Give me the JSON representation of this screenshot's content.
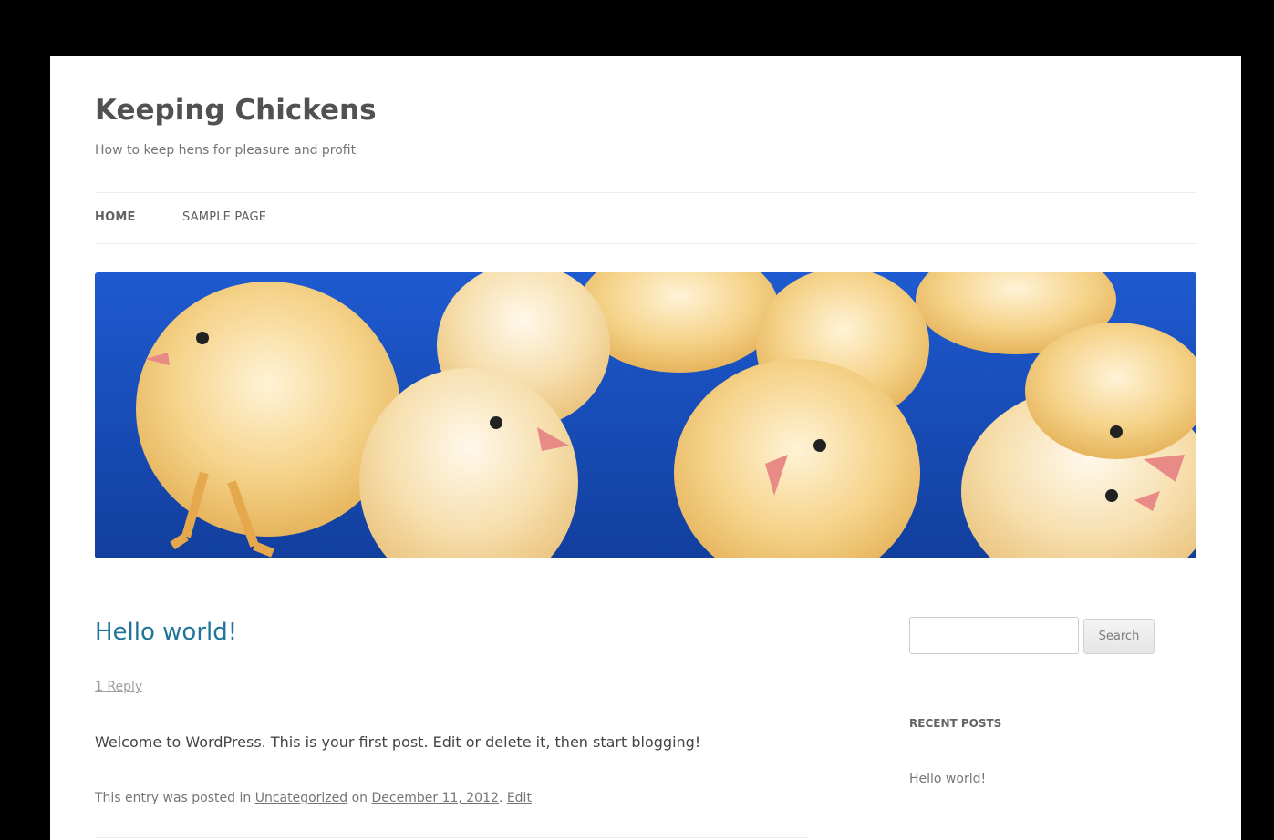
{
  "site": {
    "title": "Keeping Chickens",
    "description": "How to keep hens for pleasure and profit"
  },
  "nav": {
    "items": [
      {
        "label": "Home",
        "active": true
      },
      {
        "label": "Sample Page",
        "active": false
      }
    ]
  },
  "header_image": {
    "subject": "yellow-chicks-on-blue-background",
    "colors": {
      "background": "#1a4fbf",
      "chick": "#f5d38a",
      "beak": "#e88a86"
    }
  },
  "post": {
    "title": "Hello world!",
    "reply_link": "1 Reply",
    "content": "Welcome to WordPress. This is your first post. Edit or delete it, then start blogging!",
    "meta_prefix": "This entry was posted in",
    "category": "Uncategorized",
    "meta_on": "on",
    "date": "December 11, 2012",
    "edit_link": "Edit"
  },
  "sidebar": {
    "search": {
      "value": "",
      "button_label": "Search"
    },
    "recent_posts": {
      "title": "Recent Posts",
      "items": [
        "Hello world!"
      ]
    }
  },
  "colors": {
    "link_blue": "#21759b",
    "text": "#444444",
    "muted": "#757575"
  }
}
